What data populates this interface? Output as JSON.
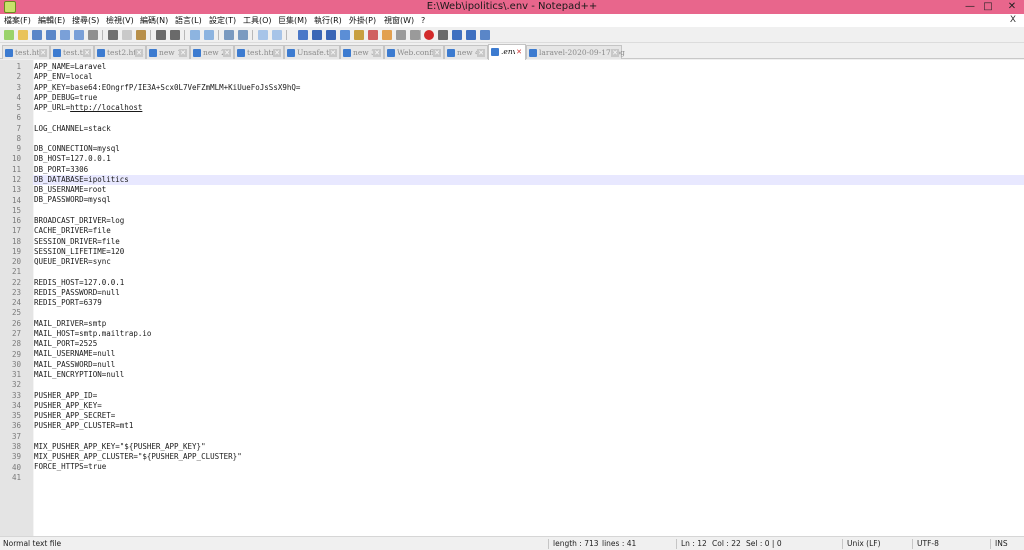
{
  "window": {
    "title": "E:\\Web\\ipolitics\\.env - Notepad++",
    "minimize_glyph": "—",
    "maximize_glyph": "□",
    "close_glyph": "✕"
  },
  "menu": {
    "items": [
      "檔案(F)",
      "編輯(E)",
      "搜尋(S)",
      "檢視(V)",
      "編碼(N)",
      "語言(L)",
      "設定(T)",
      "工具(O)",
      "巨集(M)",
      "執行(R)",
      "外掛(P)",
      "視窗(W)",
      "?"
    ],
    "close_glyph": "X"
  },
  "toolbar": {
    "icons": [
      "new-file-icon",
      "open-file-icon",
      "save-icon",
      "save-all-icon",
      "close-icon",
      "close-all-icon",
      "print-icon",
      "cut-icon",
      "copy-icon",
      "paste-icon",
      "undo-icon",
      "redo-icon",
      "find-icon",
      "replace-icon",
      "zoom-in-icon",
      "zoom-out-icon",
      "sync-scroll-icon",
      "word-wrap-icon",
      "show-all-chars-icon",
      "indent-guide-icon",
      "udl-icon",
      "doc-map-icon",
      "function-list-icon",
      "folder-workspace-icon",
      "monitor-icon",
      "record-macro-icon",
      "stop-macro-icon",
      "play-macro-icon",
      "run-macro-multiple-icon",
      "save-macro-icon"
    ]
  },
  "tabs": [
    {
      "label": "test.htm",
      "active": false
    },
    {
      "label": "test.txt",
      "active": false
    },
    {
      "label": "test2.htm",
      "active": false
    },
    {
      "label": "new 1",
      "active": false
    },
    {
      "label": "new 2",
      "active": false
    },
    {
      "label": "test.htm",
      "active": false
    },
    {
      "label": "Unsafe.txt",
      "active": false
    },
    {
      "label": "new 3",
      "active": false
    },
    {
      "label": "Web.config",
      "active": false
    },
    {
      "label": "new 4",
      "active": false
    },
    {
      "label": ".env",
      "active": true
    },
    {
      "label": "laravel-2020-09-17.log",
      "active": false
    }
  ],
  "editor": {
    "current_line": 12,
    "lines": [
      "APP_NAME=Laravel",
      "APP_ENV=local",
      "APP_KEY=base64:EOngrfP/IE3A+Scx0L7VeFZmMLM+KiUueFoJsSsX9hQ=",
      "APP_DEBUG=true",
      "APP_URL=http://localhost",
      "",
      "LOG_CHANNEL=stack",
      "",
      "DB_CONNECTION=mysql",
      "DB_HOST=127.0.0.1",
      "DB_PORT=3306",
      "DB_DATABASE=ipolitics",
      "DB_USERNAME=root",
      "DB_PASSWORD=mysql",
      "",
      "BROADCAST_DRIVER=log",
      "CACHE_DRIVER=file",
      "SESSION_DRIVER=file",
      "SESSION_LIFETIME=120",
      "QUEUE_DRIVER=sync",
      "",
      "REDIS_HOST=127.0.0.1",
      "REDIS_PASSWORD=null",
      "REDIS_PORT=6379",
      "",
      "MAIL_DRIVER=smtp",
      "MAIL_HOST=smtp.mailtrap.io",
      "MAIL_PORT=2525",
      "MAIL_USERNAME=null",
      "MAIL_PASSWORD=null",
      "MAIL_ENCRYPTION=null",
      "",
      "PUSHER_APP_ID=",
      "PUSHER_APP_KEY=",
      "PUSHER_APP_SECRET=",
      "PUSHER_APP_CLUSTER=mt1",
      "",
      "MIX_PUSHER_APP_KEY=\"${PUSHER_APP_KEY}\"",
      "MIX_PUSHER_APP_CLUSTER=\"${PUSHER_APP_CLUSTER}\"",
      "FORCE_HTTPS=true",
      ""
    ]
  },
  "status": {
    "file_type": "Normal text file",
    "length": "length : 713",
    "lines": "lines : 41",
    "ln": "Ln : 12",
    "col": "Col : 22",
    "sel": "Sel : 0 | 0",
    "eol": "Unix (LF)",
    "encoding": "UTF-8",
    "mode": "INS"
  },
  "colors": {
    "titlebar": "#e8668c",
    "current_line": "#e8e8ff",
    "gutter": "#e4e4e4"
  }
}
